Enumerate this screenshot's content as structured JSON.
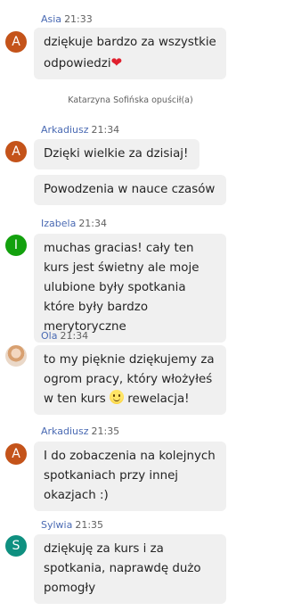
{
  "messages": [
    {
      "author": "Asia",
      "time": "21:33",
      "initial": "A",
      "avatar_color": "#c4531a",
      "bubbles": [
        "dziękuje bardzo za wszystkie odpowiedzi"
      ],
      "has_heart": true
    },
    {
      "author": "Arkadiusz",
      "time": "21:34",
      "initial": "A",
      "avatar_color": "#c4531a",
      "bubbles": [
        "Dzięki wielkie za dzisiaj!",
        "Powodzenia w nauce czasów"
      ]
    },
    {
      "author": "Izabela",
      "time": "21:34",
      "initial": "I",
      "avatar_color": "#13a10e",
      "bubbles": [
        "muchas gracias! cały ten kurs jest świetny ale moje ulubione były spotkania które były bardzo merytoryczne"
      ]
    },
    {
      "author": "Ola",
      "time": "21:34",
      "initial": "",
      "avatar_color": "#e8d0bb",
      "bubbles": [
        "to my pięknie dziękujemy za ogrom pracy, który włożyłeś w ten kurs",
        "rewelacja!"
      ]
    },
    {
      "author": "Arkadiusz",
      "time": "21:35",
      "initial": "A",
      "avatar_color": "#c4531a",
      "bubbles": [
        "I do zobaczenia na kolejnych spotkaniach przy innej okazjach :)"
      ]
    },
    {
      "author": "Sylwia",
      "time": "21:35",
      "initial": "S",
      "avatar_color": "#0f9080",
      "bubbles": [
        "dziękuję za kurs i za spotkania, naprawdę dużo pomogły"
      ]
    }
  ],
  "system": {
    "left_notice": "Katarzyna Sofińska opuścił(a)"
  },
  "colors": {
    "author_name": "#4a6ab3",
    "bubble_bg": "#f0f0f0"
  }
}
